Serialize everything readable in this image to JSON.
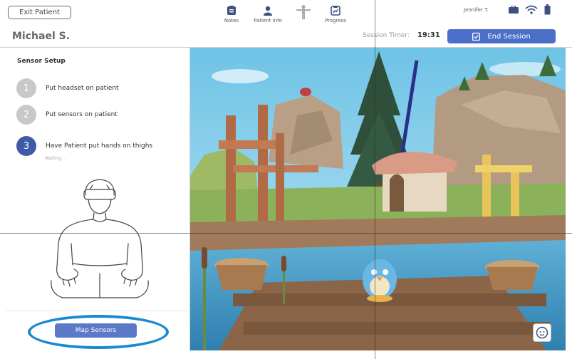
{
  "header": {
    "exit_label": "Exit Patient",
    "patient_name": "Michael S.",
    "nav": [
      {
        "label": "Notes",
        "icon": "notes-icon"
      },
      {
        "label": "Patient Info",
        "icon": "person-icon"
      },
      {
        "label": "",
        "icon": "body-icon"
      },
      {
        "label": "Progress",
        "icon": "progress-icon"
      }
    ],
    "user_name": "Jennifer T.",
    "timer_label": "Session Timer:",
    "timer_value": "19:31",
    "end_session_label": "End Session"
  },
  "sensor_setup": {
    "title": "Sensor Setup",
    "steps": [
      {
        "num": "1",
        "label": "Put headset on patient",
        "state": "done"
      },
      {
        "num": "2",
        "label": "Put sensors on patient",
        "state": "done"
      },
      {
        "num": "3",
        "label": "Have Patient put hands on thighs",
        "state": "active"
      }
    ],
    "waiting_text": "Waiting...",
    "map_button_label": "Map Sensors"
  },
  "colors": {
    "accent": "#4b6fc8",
    "active_step": "#3f5aa6",
    "inactive_step": "#c8c8c8",
    "highlight": "#1a8ad0"
  }
}
